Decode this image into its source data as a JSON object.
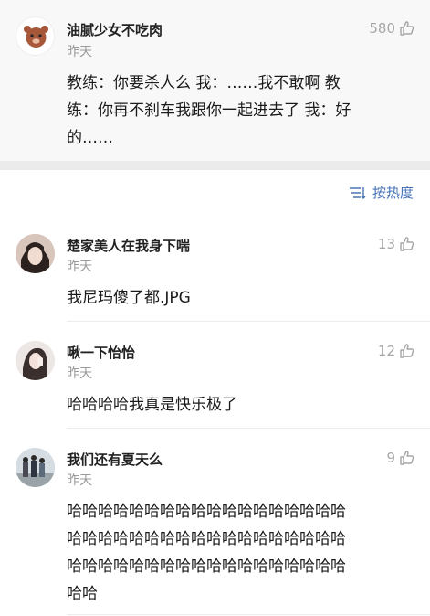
{
  "top_post": {
    "username": "油腻少女不吃肉",
    "time": "昨天",
    "likes": "580",
    "lines": [
      "教练：你要杀人么 我：……我不敢啊 教",
      "练：你再不刹车我跟你一起进去了 我：好",
      "的……"
    ]
  },
  "sort": {
    "label": "按热度"
  },
  "comments": [
    {
      "username": "楚家美人在我身下喘",
      "time": "昨天",
      "likes": "13",
      "lines": [
        "我尼玛傻了都.JPG"
      ]
    },
    {
      "username": "啾一下怡怡",
      "time": "昨天",
      "likes": "12",
      "lines": [
        "哈哈哈哈我真是快乐极了"
      ]
    },
    {
      "username": "我们还有夏天么",
      "time": "昨天",
      "likes": "9",
      "lines": [
        "哈哈哈哈哈哈哈哈哈哈哈哈哈哈哈哈哈哈",
        "哈哈哈哈哈哈哈哈哈哈哈哈哈哈哈哈哈哈",
        "哈哈哈哈哈哈哈哈哈哈哈哈哈哈哈哈哈哈",
        "哈哈"
      ]
    }
  ],
  "colors": {
    "accent": "#4a74b8",
    "muted": "#9a9a9a",
    "band": "#ebebeb"
  },
  "icons": [
    "thumbs-up-icon",
    "sort-icon"
  ]
}
